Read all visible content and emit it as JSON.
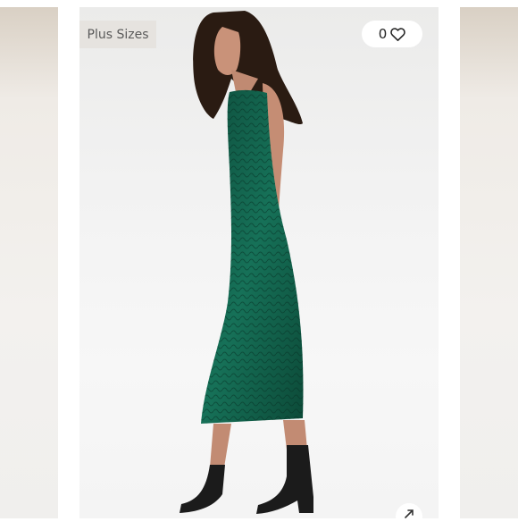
{
  "badge": {
    "label": "Plus Sizes"
  },
  "likes": {
    "count": "0",
    "icon": "heart-icon"
  },
  "expand": {
    "icon": "expand-icon"
  },
  "colors": {
    "dress": "#0f5a45",
    "boots": "#1c1c1c",
    "badge_bg": "#e6e3df"
  }
}
